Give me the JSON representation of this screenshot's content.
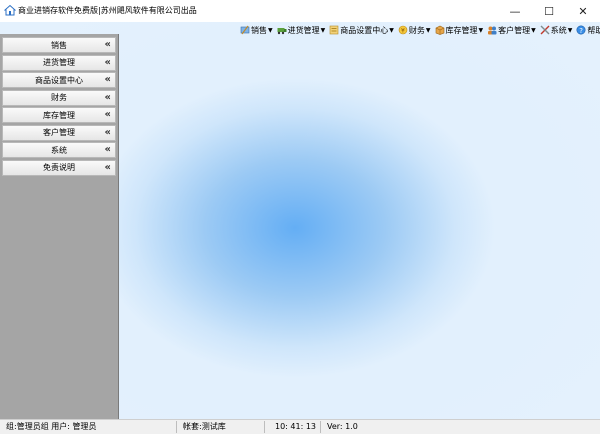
{
  "title_bar": {
    "title": "商业进销存软件免费版|苏州飓风软件有限公司出品",
    "minimize": "—",
    "maximize": "☐",
    "close": "✕"
  },
  "menu": [
    {
      "label": "销售",
      "icon": "sales-icon"
    },
    {
      "label": "进货管理",
      "icon": "purchase-icon"
    },
    {
      "label": "商品设置中心",
      "icon": "product-settings-icon"
    },
    {
      "label": "财务",
      "icon": "finance-icon"
    },
    {
      "label": "库存管理",
      "icon": "inventory-icon"
    },
    {
      "label": "客户管理",
      "icon": "customer-icon"
    },
    {
      "label": "系统",
      "icon": "system-icon"
    },
    {
      "label": "帮助",
      "icon": "help-icon"
    }
  ],
  "sidebar": {
    "items": [
      {
        "label": "销售",
        "arrow": "«"
      },
      {
        "label": "进货管理",
        "arrow": "«"
      },
      {
        "label": "商品设置中心",
        "arrow": "«"
      },
      {
        "label": "财务",
        "arrow": "«"
      },
      {
        "label": "库存管理",
        "arrow": "«"
      },
      {
        "label": "客户管理",
        "arrow": "«"
      },
      {
        "label": "系统",
        "arrow": "«"
      },
      {
        "label": "免责说明",
        "arrow": "«"
      }
    ]
  },
  "status_bar": {
    "group_user": "组:管理员组 用户: 管理员",
    "account": "帐套:测试库",
    "time": "10: 41: 13",
    "version": "Ver: 1.0"
  }
}
